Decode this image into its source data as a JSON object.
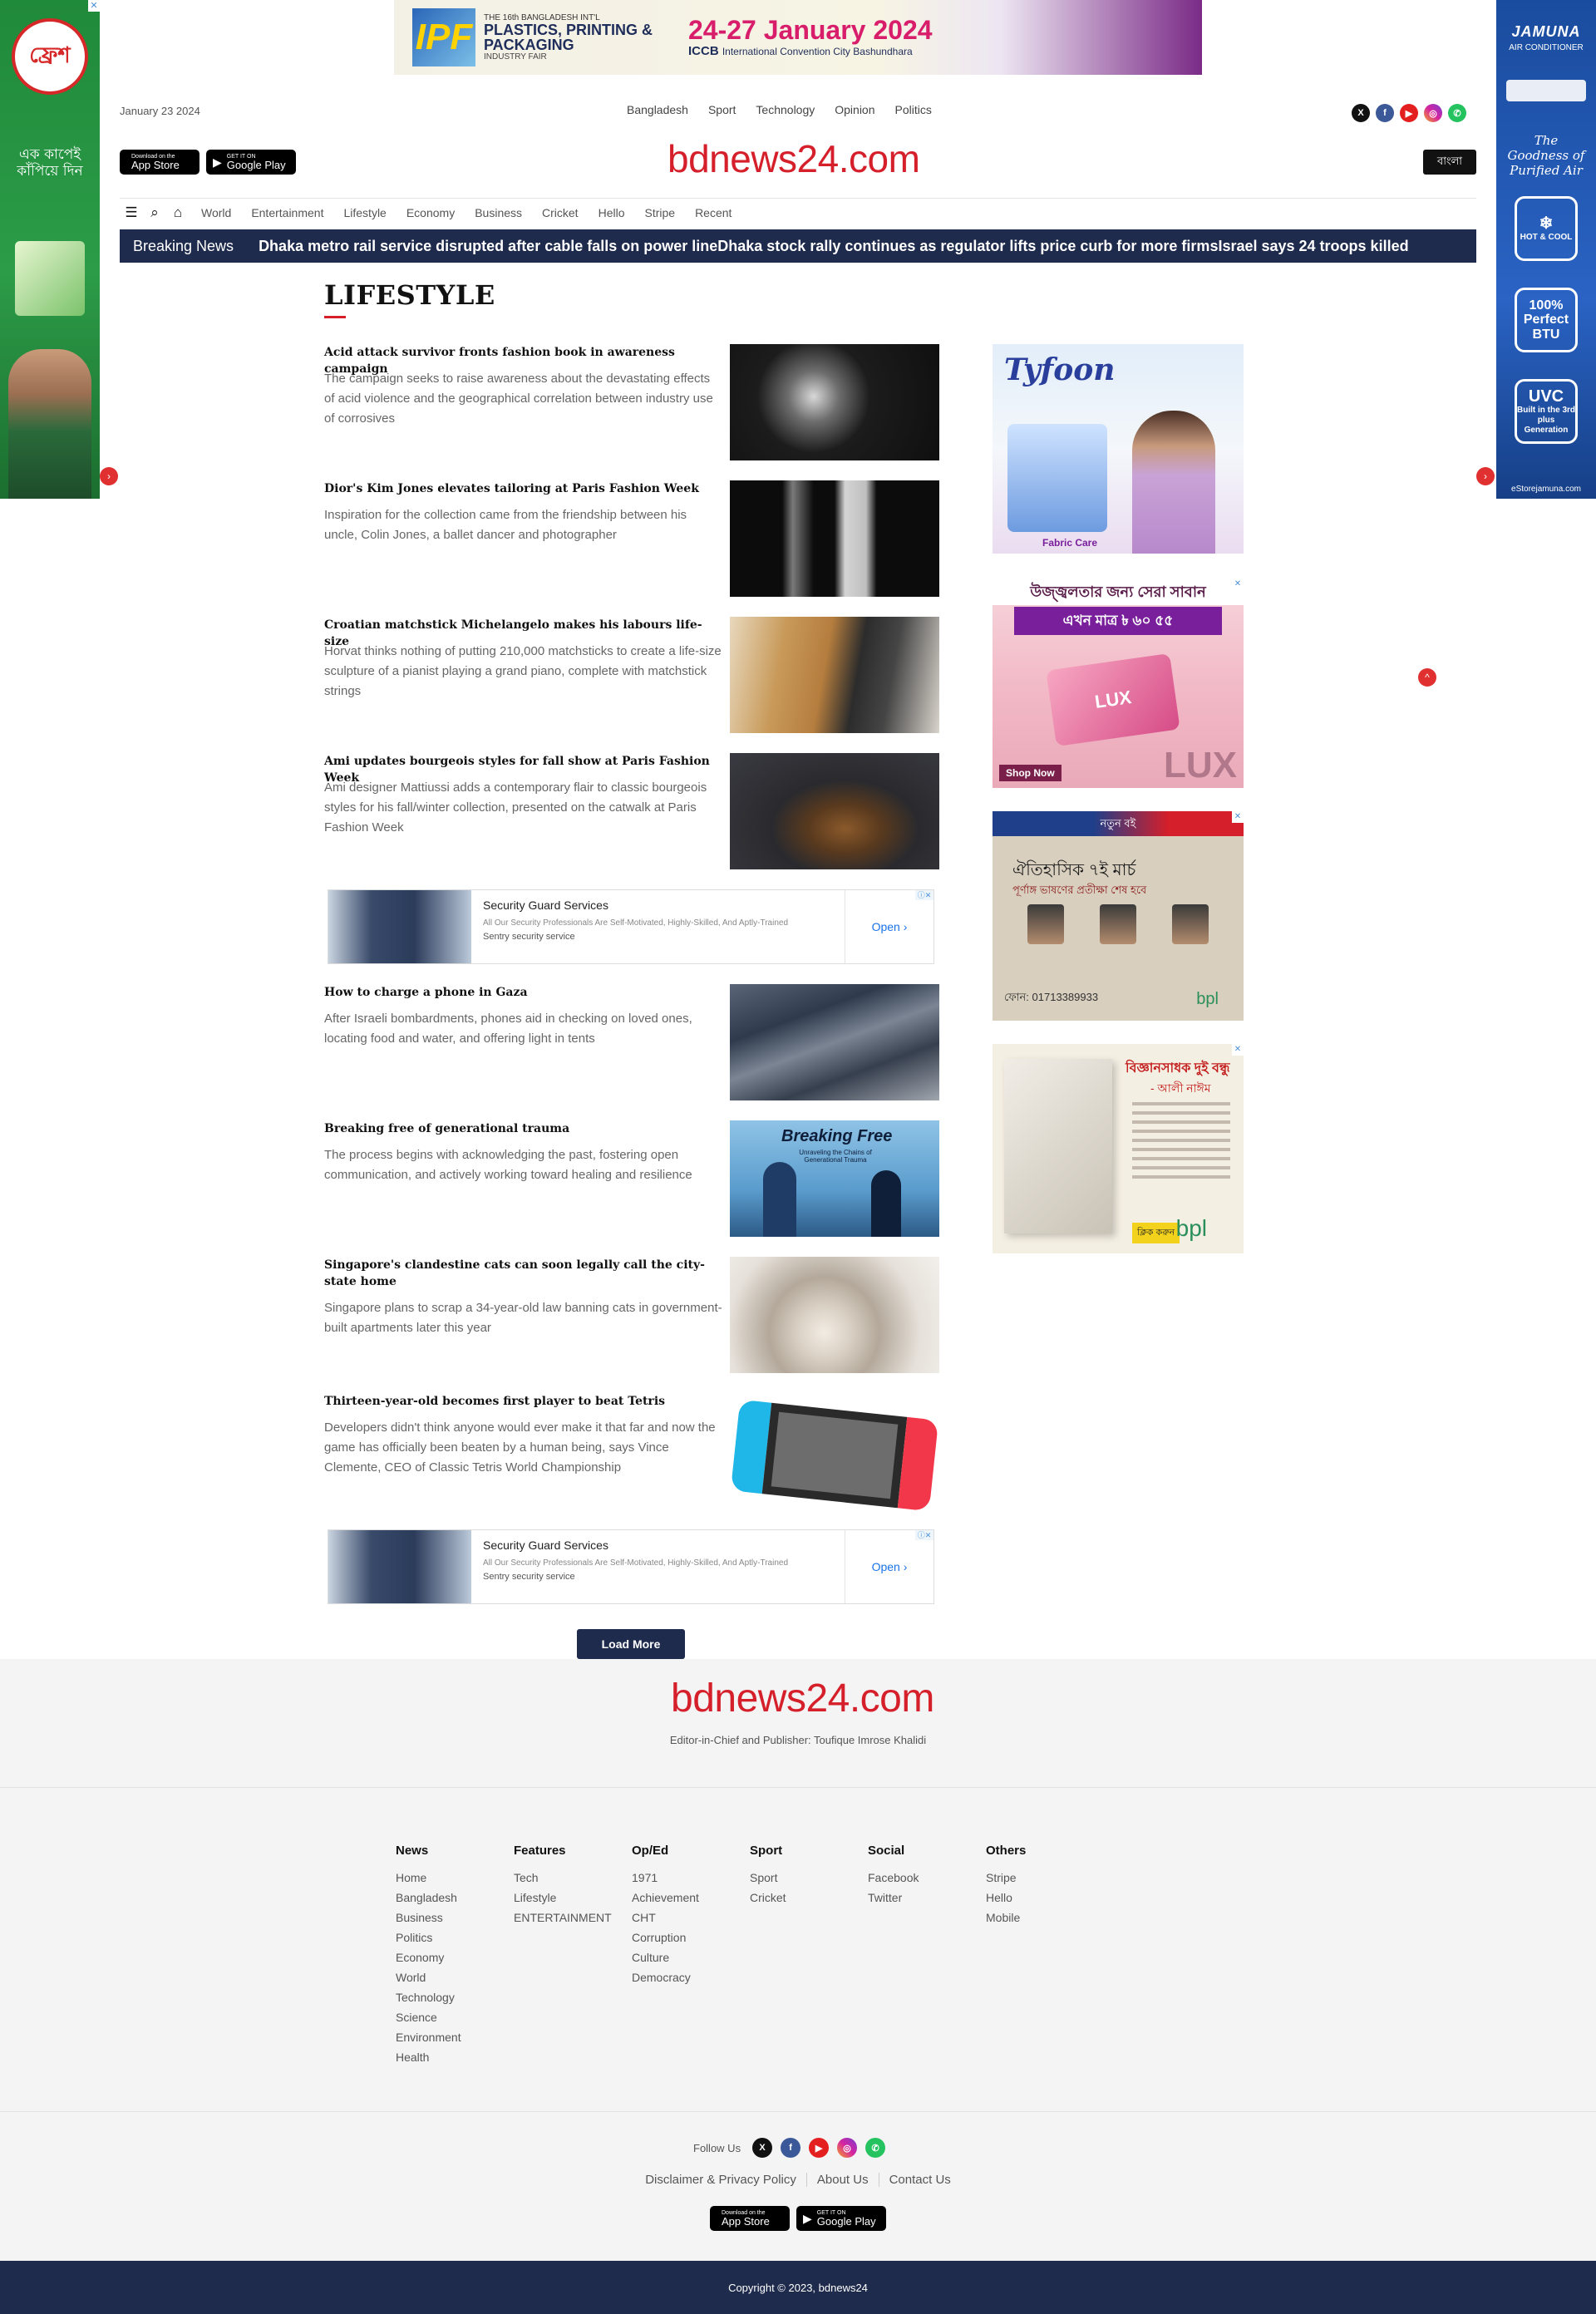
{
  "left_rail_ad": {
    "logo_text": "ফ্রেশ",
    "slogan": "এক কাপেই কাঁপিয়ে দিন",
    "close": "✕",
    "arrow": "›"
  },
  "right_rail_ad": {
    "brand": "JAMUNA",
    "sub": "AIR CONDITIONER",
    "tagline": "The Goodness of Purified Air",
    "badge1_big": "❄",
    "badge1_small": "HOT & COOL",
    "badge2_big": "100% Perfect BTU",
    "badge3_big": "UVC",
    "badge3_small": "Built in the 3rd plus Generation",
    "footer": "eStorejamuna.com",
    "arrow": "›"
  },
  "top_banner": {
    "logo": "IPF",
    "line1": "THE 16th BANGLADESH INT'L",
    "line2": "PLASTICS, PRINTING & PACKAGING",
    "line3": "INDUSTRY FAIR",
    "dates": "24-27 January 2024",
    "venue_code": "ICCB",
    "venue": "International Convention City Bashundhara"
  },
  "header": {
    "date": "January 23 2024",
    "top_nav": [
      "Bangladesh",
      "Sport",
      "Technology",
      "Opinion",
      "Politics"
    ],
    "socials": [
      "X",
      "f",
      "▶",
      "◎",
      "✆"
    ],
    "app_store": {
      "small": "Download on the",
      "big": "App Store"
    },
    "google_play": {
      "small": "GET IT ON",
      "big": "Google Play"
    },
    "logo": "bdnews24.com",
    "bangla_button": "বাংলা"
  },
  "main_nav": {
    "menu_icon": "☰",
    "search_icon": "⌕",
    "home_icon": "⌂",
    "items": [
      "World",
      "Entertainment",
      "Lifestyle",
      "Economy",
      "Business",
      "Cricket",
      "Hello",
      "Stripe",
      "Recent"
    ]
  },
  "breaking": {
    "label": "Breaking News",
    "items": [
      "Dhaka metro rail service disrupted after cable falls on power line",
      "Dhaka stock rally continues as regulator lifts price curb for more firms",
      "Israel says 24 troops killed"
    ]
  },
  "section": {
    "title": "LIFESTYLE"
  },
  "articles": [
    {
      "title": "Acid attack survivor fronts fashion book in awareness campaign",
      "summary": "The campaign seeks to raise awareness about the devastating effects of acid violence and the geographical correlation between industry use of corrosives"
    },
    {
      "title": "Dior's Kim Jones elevates tailoring at Paris Fashion Week",
      "summary": "Inspiration for the collection came from the friendship between his uncle, Colin Jones, a ballet dancer and photographer"
    },
    {
      "title": "Croatian matchstick Michelangelo makes his labours life-size",
      "summary": "Horvat thinks nothing of putting 210,000 matchsticks to create a life-size sculpture of a pianist playing a grand piano, complete with matchstick strings"
    },
    {
      "title": "Ami updates bourgeois styles for fall show at Paris Fashion Week",
      "summary": "Ami designer Mattiussi adds a contemporary flair to classic bourgeois styles for his fall/winter collection, presented on the catwalk at Paris Fashion Week"
    },
    {
      "title": "How to charge a phone in Gaza",
      "summary": "After Israeli bombardments, phones aid in checking on loved ones, locating food and water, and offering light in tents"
    },
    {
      "title": "Breaking free of generational trauma",
      "summary": "The process begins with acknowledging the past, fostering open communication, and actively working toward healing and resilience",
      "image_text": "Breaking Free",
      "image_sub": "Unraveling the Chains of Generational Trauma"
    },
    {
      "title": "Singapore's clandestine cats can soon legally call the city-state home",
      "summary": "Singapore plans to scrap a 34-year-old law banning cats in government-built apartments later this year"
    },
    {
      "title": "Thirteen-year-old becomes first player to beat Tetris",
      "summary": "Developers didn't think anyone would ever make it that far and now the game has officially been beaten by a human being, says Vince Clemente, CEO of Classic Tetris World Championship"
    }
  ],
  "inline_ad": {
    "title": "Security Guard Services",
    "desc": "All Our Security Professionals Are Self-Motivated, Highly-Skilled, And Aptly-Trained",
    "source": "Sentry security service",
    "button": "Open",
    "chevron": "›",
    "corner": "ⓘ✕"
  },
  "sidebar_ads": {
    "ad1": {
      "brand": "Tyfoon",
      "caption": "Fabric Care"
    },
    "ad2": {
      "header": "উজ্জ্বলতার জন্য সেরা সাবান",
      "offer": "এখন মাত্র ৳ ৬০ ৫৫",
      "product": "LUX",
      "shop": "Shop Now",
      "brand": "LUX"
    },
    "ad3": {
      "top": "নতুন বই",
      "title": "ঐতিহাসিক ৭ই মার্চ",
      "sub": "পূর্ণাঙ্গ ভাষণের প্রতীক্ষা শেষ হবে",
      "phone": "ফোন: 01713389933",
      "brand": "bpl"
    },
    "ad4": {
      "title": "বিজ্ঞানসাধক দুই বন্ধু",
      "author": "- আলী নাঈম",
      "button": "ক্লিক করুন",
      "brand": "bpl"
    },
    "close": "✕"
  },
  "load_more": "Load More",
  "footer": {
    "logo": "bdnews24.com",
    "editor": "Editor-in-Chief and Publisher: Toufique Imrose Khalidi",
    "columns": [
      {
        "heading": "News",
        "links": [
          "Home",
          "Bangladesh",
          "Business",
          "Politics",
          "Economy",
          "World",
          "Technology",
          "Science",
          "Environment",
          "Health"
        ]
      },
      {
        "heading": "Features",
        "links": [
          "Tech",
          "Lifestyle",
          "ENTERTAINMENT"
        ]
      },
      {
        "heading": "Op/Ed",
        "links": [
          "1971",
          "Achievement",
          "CHT",
          "Corruption",
          "Culture",
          "Democracy"
        ]
      },
      {
        "heading": "Sport",
        "links": [
          "Sport",
          "Cricket"
        ]
      },
      {
        "heading": "Social",
        "links": [
          "Facebook",
          "Twitter"
        ]
      },
      {
        "heading": "Others",
        "links": [
          "Stripe",
          "Hello",
          "Mobile"
        ]
      }
    ],
    "follow_us": "Follow Us",
    "links": [
      "Disclaimer & Privacy Policy",
      "About Us",
      "Contact Us"
    ],
    "copyright": "Copyright © 2023, bdnews24"
  }
}
